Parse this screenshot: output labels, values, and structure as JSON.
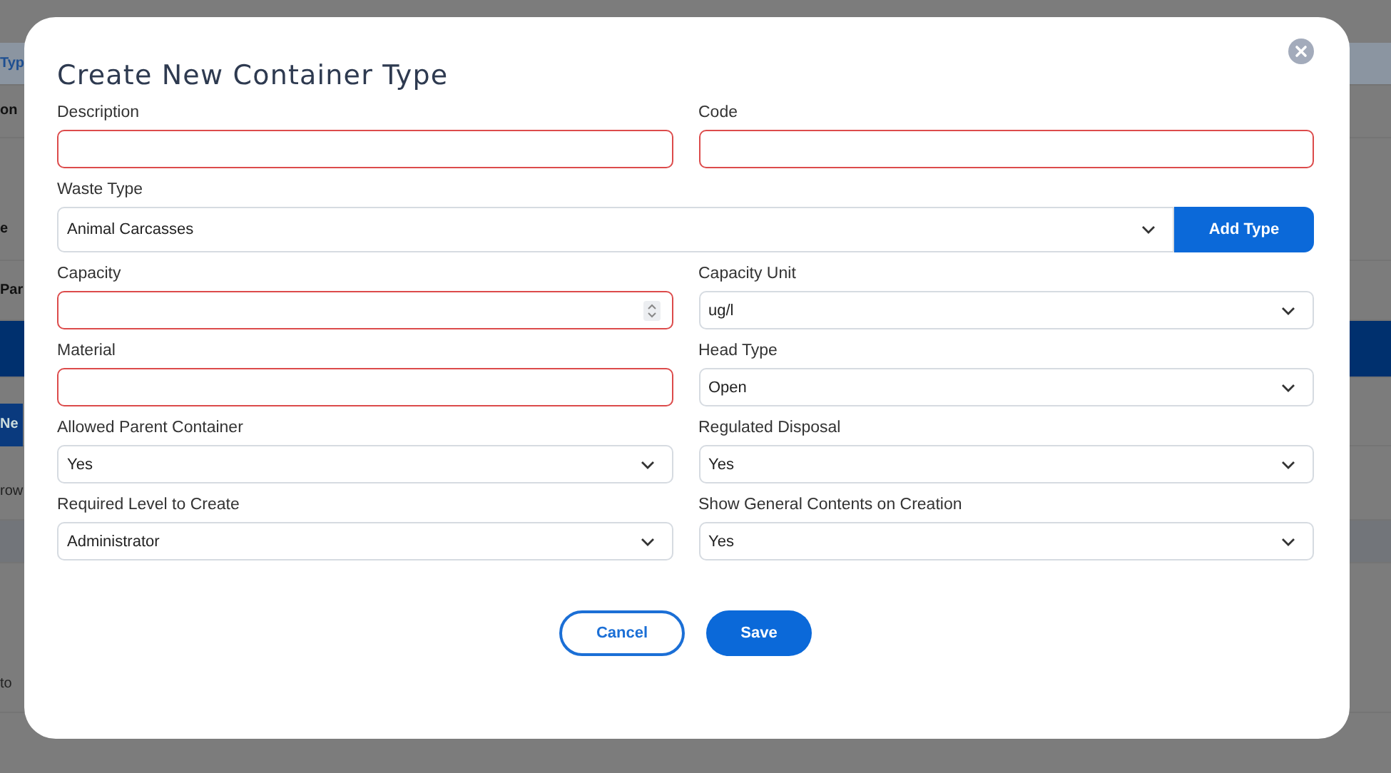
{
  "background": {
    "rows": [
      {
        "kind": "blank"
      },
      {
        "kind": "tab",
        "text": "Typ"
      },
      {
        "kind": "bold",
        "text": "on"
      },
      {
        "kind": "blank"
      },
      {
        "kind": "bold",
        "text": "e"
      },
      {
        "kind": "bold",
        "text": "Par"
      },
      {
        "kind": "band"
      },
      {
        "kind": "blank"
      },
      {
        "kind": "button",
        "text": "Ne"
      },
      {
        "kind": "blank"
      },
      {
        "kind": "text",
        "text": "row"
      },
      {
        "kind": "shade"
      },
      {
        "kind": "blank"
      },
      {
        "kind": "text",
        "text": "to"
      },
      {
        "kind": "blank"
      }
    ]
  },
  "dialog": {
    "title": "Create New Container Type",
    "fields": [
      {
        "label": "Description",
        "kind": "text",
        "invalid": true
      },
      {
        "label": "Code",
        "kind": "text",
        "invalid": true
      },
      {
        "label": "Waste Type",
        "kind": "select_with_button",
        "value": "Animal Carcasses",
        "invalid": false,
        "button": "Add Type"
      },
      {
        "label": "Capacity",
        "kind": "number",
        "invalid": true
      },
      {
        "label": "Capacity Unit",
        "kind": "select",
        "value": "ug/l",
        "invalid": false
      },
      {
        "label": "Material",
        "kind": "text",
        "invalid": true
      },
      {
        "label": "Head Type",
        "kind": "select",
        "value": "Open",
        "invalid": false
      },
      {
        "label": "Allowed Parent Container",
        "kind": "select",
        "value": "Yes",
        "invalid": false
      },
      {
        "label": "Regulated Disposal",
        "kind": "select",
        "value": "Yes",
        "invalid": false
      },
      {
        "label": "Required Level to Create",
        "kind": "select",
        "value": "Administrator",
        "invalid": false
      },
      {
        "label": "Show General Contents on Creation",
        "kind": "select",
        "value": "Yes",
        "invalid": false
      }
    ],
    "buttons": [
      {
        "label": "Cancel",
        "kind": "secondary"
      },
      {
        "label": "Save",
        "kind": "primary"
      }
    ]
  }
}
